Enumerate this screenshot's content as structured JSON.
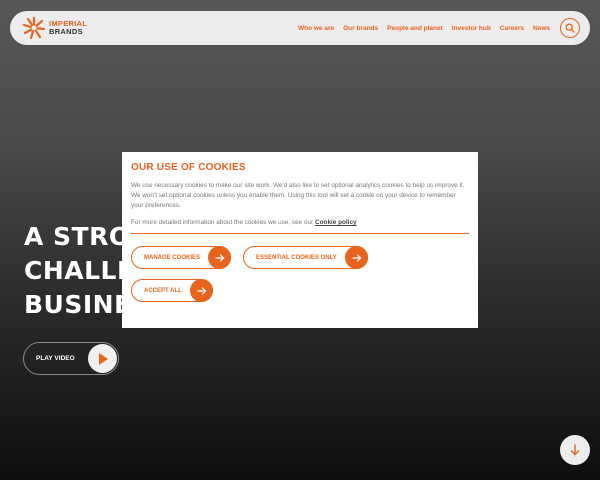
{
  "brand": {
    "line1": "IMPERIAL",
    "line2": "BRANDS",
    "accent_color": "#e8641c"
  },
  "nav": {
    "items": [
      {
        "label": "Who we are"
      },
      {
        "label": "Our brands"
      },
      {
        "label": "People and planet"
      },
      {
        "label": "Investor hub"
      },
      {
        "label": "Careers"
      },
      {
        "label": "News"
      }
    ],
    "search_icon": "search-icon"
  },
  "hero": {
    "lines": [
      "A STRO",
      "CHALLE",
      "BUSINES"
    ],
    "play_label": "PLAY VIDEO",
    "play_icon": "play-icon",
    "scroll_icon": "arrow-down-icon"
  },
  "cookies": {
    "title": "OUR USE OF COOKIES",
    "body": "We use necessary cookies to make our site work. We'd also like to set optional analytics cookies to help us improve it. We won't set optional cookies unless you enable them. Using this tool will set a cookie on your device to remember your preferences.",
    "more_info": "For more detailed information about the cookies we use, see our",
    "policy_link": "Cookie policy",
    "buttons": {
      "manage": "MANAGE COOKIES",
      "essential": "ESSENTIAL COOKIES ONLY",
      "accept": "ACCEPT ALL"
    },
    "button_icon": "arrow-right-icon"
  }
}
